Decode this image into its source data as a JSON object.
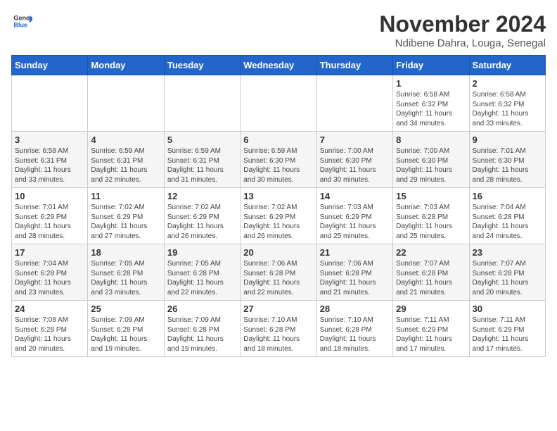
{
  "header": {
    "logo_line1": "General",
    "logo_line2": "Blue",
    "month_year": "November 2024",
    "location": "Ndibene Dahra, Louga, Senegal"
  },
  "weekdays": [
    "Sunday",
    "Monday",
    "Tuesday",
    "Wednesday",
    "Thursday",
    "Friday",
    "Saturday"
  ],
  "weeks": [
    [
      {
        "day": "",
        "info": ""
      },
      {
        "day": "",
        "info": ""
      },
      {
        "day": "",
        "info": ""
      },
      {
        "day": "",
        "info": ""
      },
      {
        "day": "",
        "info": ""
      },
      {
        "day": "1",
        "info": "Sunrise: 6:58 AM\nSunset: 6:32 PM\nDaylight: 11 hours\nand 34 minutes."
      },
      {
        "day": "2",
        "info": "Sunrise: 6:58 AM\nSunset: 6:32 PM\nDaylight: 11 hours\nand 33 minutes."
      }
    ],
    [
      {
        "day": "3",
        "info": "Sunrise: 6:58 AM\nSunset: 6:31 PM\nDaylight: 11 hours\nand 33 minutes."
      },
      {
        "day": "4",
        "info": "Sunrise: 6:59 AM\nSunset: 6:31 PM\nDaylight: 11 hours\nand 32 minutes."
      },
      {
        "day": "5",
        "info": "Sunrise: 6:59 AM\nSunset: 6:31 PM\nDaylight: 11 hours\nand 31 minutes."
      },
      {
        "day": "6",
        "info": "Sunrise: 6:59 AM\nSunset: 6:30 PM\nDaylight: 11 hours\nand 30 minutes."
      },
      {
        "day": "7",
        "info": "Sunrise: 7:00 AM\nSunset: 6:30 PM\nDaylight: 11 hours\nand 30 minutes."
      },
      {
        "day": "8",
        "info": "Sunrise: 7:00 AM\nSunset: 6:30 PM\nDaylight: 11 hours\nand 29 minutes."
      },
      {
        "day": "9",
        "info": "Sunrise: 7:01 AM\nSunset: 6:30 PM\nDaylight: 11 hours\nand 28 minutes."
      }
    ],
    [
      {
        "day": "10",
        "info": "Sunrise: 7:01 AM\nSunset: 6:29 PM\nDaylight: 11 hours\nand 28 minutes."
      },
      {
        "day": "11",
        "info": "Sunrise: 7:02 AM\nSunset: 6:29 PM\nDaylight: 11 hours\nand 27 minutes."
      },
      {
        "day": "12",
        "info": "Sunrise: 7:02 AM\nSunset: 6:29 PM\nDaylight: 11 hours\nand 26 minutes."
      },
      {
        "day": "13",
        "info": "Sunrise: 7:02 AM\nSunset: 6:29 PM\nDaylight: 11 hours\nand 26 minutes."
      },
      {
        "day": "14",
        "info": "Sunrise: 7:03 AM\nSunset: 6:29 PM\nDaylight: 11 hours\nand 25 minutes."
      },
      {
        "day": "15",
        "info": "Sunrise: 7:03 AM\nSunset: 6:28 PM\nDaylight: 11 hours\nand 25 minutes."
      },
      {
        "day": "16",
        "info": "Sunrise: 7:04 AM\nSunset: 6:28 PM\nDaylight: 11 hours\nand 24 minutes."
      }
    ],
    [
      {
        "day": "17",
        "info": "Sunrise: 7:04 AM\nSunset: 6:28 PM\nDaylight: 11 hours\nand 23 minutes."
      },
      {
        "day": "18",
        "info": "Sunrise: 7:05 AM\nSunset: 6:28 PM\nDaylight: 11 hours\nand 23 minutes."
      },
      {
        "day": "19",
        "info": "Sunrise: 7:05 AM\nSunset: 6:28 PM\nDaylight: 11 hours\nand 22 minutes."
      },
      {
        "day": "20",
        "info": "Sunrise: 7:06 AM\nSunset: 6:28 PM\nDaylight: 11 hours\nand 22 minutes."
      },
      {
        "day": "21",
        "info": "Sunrise: 7:06 AM\nSunset: 6:28 PM\nDaylight: 11 hours\nand 21 minutes."
      },
      {
        "day": "22",
        "info": "Sunrise: 7:07 AM\nSunset: 6:28 PM\nDaylight: 11 hours\nand 21 minutes."
      },
      {
        "day": "23",
        "info": "Sunrise: 7:07 AM\nSunset: 6:28 PM\nDaylight: 11 hours\nand 20 minutes."
      }
    ],
    [
      {
        "day": "24",
        "info": "Sunrise: 7:08 AM\nSunset: 6:28 PM\nDaylight: 11 hours\nand 20 minutes."
      },
      {
        "day": "25",
        "info": "Sunrise: 7:09 AM\nSunset: 6:28 PM\nDaylight: 11 hours\nand 19 minutes."
      },
      {
        "day": "26",
        "info": "Sunrise: 7:09 AM\nSunset: 6:28 PM\nDaylight: 11 hours\nand 19 minutes."
      },
      {
        "day": "27",
        "info": "Sunrise: 7:10 AM\nSunset: 6:28 PM\nDaylight: 11 hours\nand 18 minutes."
      },
      {
        "day": "28",
        "info": "Sunrise: 7:10 AM\nSunset: 6:28 PM\nDaylight: 11 hours\nand 18 minutes."
      },
      {
        "day": "29",
        "info": "Sunrise: 7:11 AM\nSunset: 6:29 PM\nDaylight: 11 hours\nand 17 minutes."
      },
      {
        "day": "30",
        "info": "Sunrise: 7:11 AM\nSunset: 6:29 PM\nDaylight: 11 hours\nand 17 minutes."
      }
    ]
  ]
}
